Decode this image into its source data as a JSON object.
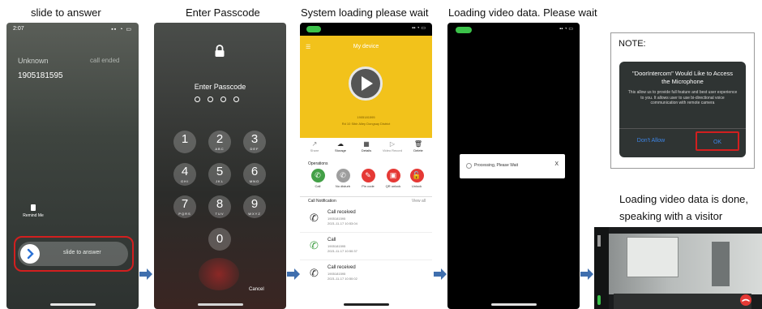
{
  "captions": {
    "step1": "slide to answer",
    "step2": "Enter Passcode",
    "step3": "System loading please wait",
    "step4": "Loading video data. Please wait",
    "step5_line1": "Loading video data is done,",
    "step5_line2": "speaking with a visitor"
  },
  "phone1": {
    "time": "2:07",
    "caller": "Unknown",
    "status": "call ended",
    "number": "1905181595",
    "remind_label": "Remind Me",
    "slide_label": "slide to answer"
  },
  "phone2": {
    "title": "Enter Passcode",
    "cancel": "Cancel",
    "keys": [
      {
        "n": "1",
        "l": ""
      },
      {
        "n": "2",
        "l": "ABC"
      },
      {
        "n": "3",
        "l": "DEF"
      },
      {
        "n": "4",
        "l": "GHI"
      },
      {
        "n": "5",
        "l": "JKL"
      },
      {
        "n": "6",
        "l": "MNO"
      },
      {
        "n": "7",
        "l": "PQRS"
      },
      {
        "n": "8",
        "l": "TUV"
      },
      {
        "n": "9",
        "l": "WXYZ"
      },
      {
        "n": "0",
        "l": ""
      }
    ]
  },
  "phone3": {
    "header_title": "My device",
    "device_id": "1905181595",
    "address": "Rd 10 Sibir Alley Dongsay District",
    "tabs": [
      "Share",
      "Storage",
      "Details",
      "Video Record",
      "Delete"
    ],
    "operations_label": "Operations",
    "operations": [
      "Call",
      "No disturb",
      "Pin code",
      "QR unlock",
      "Unlock"
    ],
    "notification_label": "Call Notification",
    "view_all": "View all",
    "records": [
      {
        "title": "Call received",
        "id": "1905181595",
        "time": "2021-11-17 10:53:04"
      },
      {
        "title": "Call",
        "id": "1905181595",
        "time": "2021-11-17 10:50:37"
      },
      {
        "title": "Call received",
        "id": "1905181595",
        "time": "2021-11-17 10:50:02"
      }
    ],
    "colors": {
      "yellow": "#f2c21b",
      "green": "#43a047",
      "grey": "#9e9e9e",
      "red": "#e53935"
    }
  },
  "phone4": {
    "processing": "Processing, Please Wait",
    "close": "X"
  },
  "note": {
    "title": "NOTE:",
    "dialog_title": "\"DoorIntercom\" Would Like to Access the Microphone",
    "dialog_body": "This allow us to provide full feature and best user experience to you. It allows user to use bi-directional voice communication with remote camera",
    "deny": "Don't Allow",
    "ok": "OK"
  }
}
